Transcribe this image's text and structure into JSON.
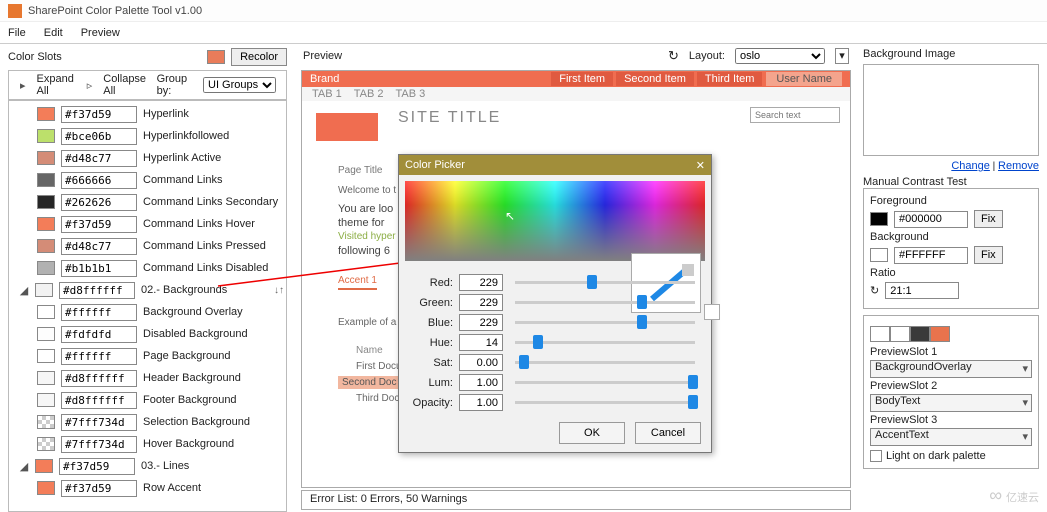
{
  "window_title": "SharePoint Color Palette Tool v1.00",
  "menus": [
    "File",
    "Edit",
    "Preview"
  ],
  "left": {
    "header": "Color Slots",
    "recolor": "Recolor",
    "recolor_swatch": "#e97c5a",
    "expand": "Expand All",
    "collapse": "Collapse All",
    "groupby_label": "Group by:",
    "groupby_value": "UI Groups",
    "slots": [
      {
        "hex": "#f37d59",
        "name": "Hyperlink",
        "c": "#f37d59"
      },
      {
        "hex": "#bce06b",
        "name": "Hyperlinkfollowed",
        "c": "#bce06b"
      },
      {
        "hex": "#d48c77",
        "name": "Hyperlink Active",
        "c": "#d48c77"
      },
      {
        "hex": "#666666",
        "name": "Command Links",
        "c": "#666666"
      },
      {
        "hex": "#262626",
        "name": "Command Links Secondary",
        "c": "#262626"
      },
      {
        "hex": "#f37d59",
        "name": "Command Links Hover",
        "c": "#f37d59"
      },
      {
        "hex": "#d48c77",
        "name": "Command Links Pressed",
        "c": "#d48c77"
      },
      {
        "hex": "#b1b1b1",
        "name": "Command Links Disabled",
        "c": "#b1b1b1"
      }
    ],
    "group_bg": {
      "hex": "#d8ffffff",
      "name": "02.- Backgrounds",
      "c": "#f2f2f2"
    },
    "bg_slots": [
      {
        "hex": "#ffffff",
        "name": "Background Overlay",
        "c": "#ffffff"
      },
      {
        "hex": "#fdfdfd",
        "name": "Disabled Background",
        "c": "#fdfdfd"
      },
      {
        "hex": "#ffffff",
        "name": "Page Background",
        "c": "#ffffff"
      },
      {
        "hex": "#d8ffffff",
        "name": "Header Background",
        "c": "#f6f6f6"
      },
      {
        "hex": "#d8ffffff",
        "name": "Footer Background",
        "c": "#f6f6f6"
      },
      {
        "hex": "#7fff734d",
        "name": "Selection Background",
        "c": "#f2b79f",
        "checker": true
      },
      {
        "hex": "#7fff734d",
        "name": "Hover Background",
        "c": "#f2b79f",
        "checker": true
      }
    ],
    "group_lines": {
      "hex": "#f37d59",
      "name": "03.- Lines",
      "c": "#f37d59"
    },
    "line_slots": [
      {
        "hex": "#f37d59",
        "name": "Row Accent",
        "c": "#f37d59"
      }
    ]
  },
  "mid": {
    "header": "Preview",
    "layout_label": "Layout:",
    "layout_value": "oslo",
    "brand": "Brand",
    "nav": [
      "First Item",
      "Second Item",
      "Third Item"
    ],
    "user": "User Name",
    "tabs": [
      "TAB 1",
      "TAB 2",
      "TAB 3"
    ],
    "site_title": "SITE TITLE",
    "search_ph": "Search text",
    "page_title": "Page Title",
    "welcome": "Welcome to t",
    "looking": "You are loo",
    "theme": "theme for",
    "visited": "Visited hyper",
    "following": "following 6",
    "accent": "Accent 1",
    "example": "Example of a l",
    "name": "Name",
    "doc1": "First Docum",
    "doc2": "Second Doc",
    "doc3": "Third Docum",
    "errorbar": "Error List: 0 Errors, 50 Warnings"
  },
  "picker": {
    "title": "Color Picker",
    "channels": [
      {
        "label": "Red:",
        "value": "229",
        "pos": 40
      },
      {
        "label": "Green:",
        "value": "229",
        "pos": 68
      },
      {
        "label": "Blue:",
        "value": "229",
        "pos": 68
      },
      {
        "label": "Hue:",
        "value": "14",
        "pos": 10
      },
      {
        "label": "Sat:",
        "value": "0.00",
        "pos": 2
      },
      {
        "label": "Lum:",
        "value": "1.00",
        "pos": 96
      },
      {
        "label": "Opacity:",
        "value": "1.00",
        "pos": 96
      }
    ],
    "ok": "OK",
    "cancel": "Cancel"
  },
  "right": {
    "bgimg_label": "Background Image",
    "change": "Change",
    "remove": "Remove",
    "contrast_label": "Manual Contrast Test",
    "fg_label": "Foreground",
    "fg_hex": "#000000",
    "bg_label": "Background",
    "bg_hex": "#FFFFFF",
    "fix": "Fix",
    "ratio_label": "Ratio",
    "ratio_value": "21:1",
    "pal": [
      "#ffffff",
      "#ffffff",
      "#3a3a3a",
      "#e8734d"
    ],
    "ps1": "PreviewSlot 1",
    "ps1v": "BackgroundOverlay",
    "ps2": "PreviewSlot 2",
    "ps2v": "BodyText",
    "ps3": "PreviewSlot 3",
    "ps3v": "AccentText",
    "light": "Light on dark palette"
  },
  "watermark": "亿速云"
}
